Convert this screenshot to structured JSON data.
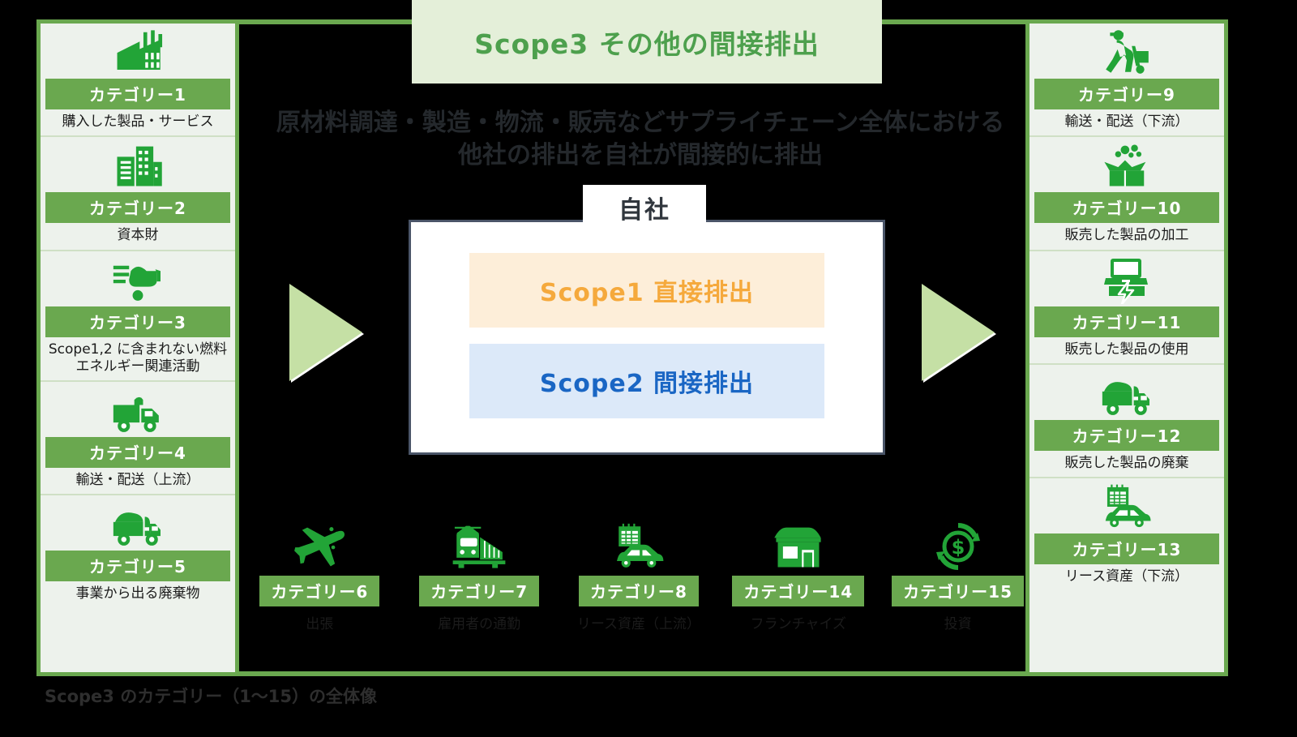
{
  "title": "Scope3  その他の間接排出",
  "subtitle_line1": "原材料調達・製造・物流・販売などサプライチェーン全体における",
  "subtitle_line2": "他社の排出を自社が間接的に排出",
  "company": {
    "tab_label": "自社",
    "scope1_label": "Scope1 直接排出",
    "scope2_label": "Scope2 間接排出"
  },
  "colors": {
    "green_badge": "#6aa84f",
    "green_icon": "#22a437",
    "panel_bg": "#edf2ec",
    "title_bg": "#e4efd9",
    "title_text": "#4da04d",
    "scope1_bg": "#fdeed9",
    "scope1_text": "#f5a93c",
    "scope2_bg": "#dce9f9",
    "scope2_text": "#1a66c4",
    "arrow": "#c5e0a5"
  },
  "upstream": {
    "panel_name": "upstream-categories",
    "items": [
      {
        "badge": "カテゴリー1",
        "label": "購入した製品・サービス",
        "icon": "factory-icon",
        "num": "1"
      },
      {
        "badge": "カテゴリー2",
        "label": "資本財",
        "icon": "buildings-icon",
        "num": "2"
      },
      {
        "badge": "カテゴリー3",
        "label": "Scope1,2 に含まれない燃料\nエネルギー関連活動",
        "icon": "fuel-wheelbarrow-icon",
        "num": "3"
      },
      {
        "badge": "カテゴリー4",
        "label": "輸送・配送（上流）",
        "icon": "delivery-truck-icon",
        "num": "4"
      },
      {
        "badge": "カテゴリー5",
        "label": "事業から出る廃棄物",
        "icon": "waste-truck-icon",
        "num": "5"
      }
    ]
  },
  "downstream": {
    "panel_name": "downstream-categories",
    "items": [
      {
        "badge": "カテゴリー9",
        "label": "輸送・配送（下流）",
        "icon": "handtruck-worker-icon",
        "num": "9"
      },
      {
        "badge": "カテゴリー10",
        "label": "販売した製品の加工",
        "icon": "open-box-icon",
        "num": "10"
      },
      {
        "badge": "カテゴリー11",
        "label": "販売した製品の使用",
        "icon": "laptop-power-icon",
        "num": "11"
      },
      {
        "badge": "カテゴリー12",
        "label": "販売した製品の廃棄",
        "icon": "waste-truck-icon",
        "num": "12"
      },
      {
        "badge": "カテゴリー13",
        "label": "リース資産（下流）",
        "icon": "calendar-car-icon",
        "num": "13"
      }
    ]
  },
  "bottom": {
    "panel_name": "other-categories",
    "items": [
      {
        "badge": "カテゴリー6",
        "label": "出張",
        "icon": "airplane-icon",
        "num": "6"
      },
      {
        "badge": "カテゴリー7",
        "label": "雇用者の通勤",
        "icon": "train-icon",
        "num": "7"
      },
      {
        "badge": "カテゴリー8",
        "label": "リース資産（上流）",
        "icon": "calendar-car-icon",
        "num": "8"
      },
      {
        "badge": "カテゴリー14",
        "label": "フランチャイズ",
        "icon": "storefront-icon",
        "num": "14"
      },
      {
        "badge": "カテゴリー15",
        "label": "投資",
        "icon": "dollar-recycle-icon",
        "num": "15"
      }
    ]
  },
  "footer": {
    "caption": "Scope3 のカテゴリー（1〜15）の全体像"
  }
}
